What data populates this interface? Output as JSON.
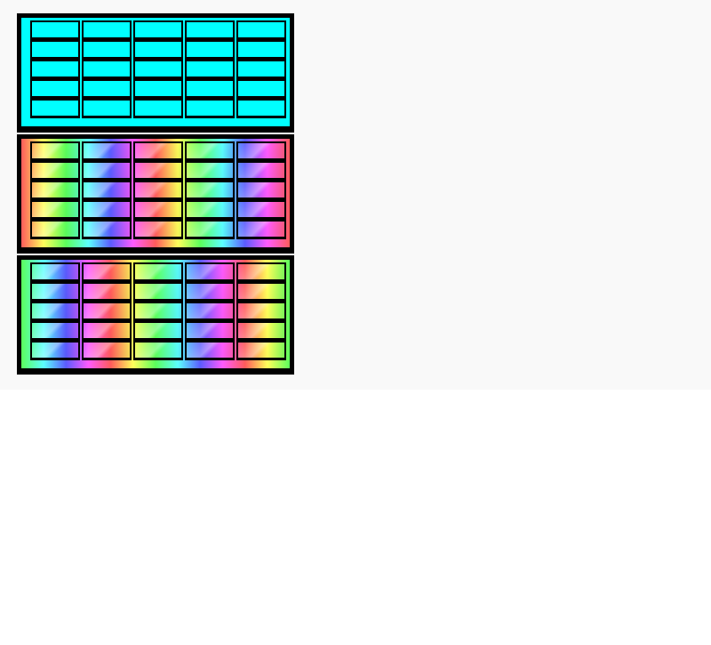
{
  "panels": [
    {
      "id": "panel-1",
      "fill": "solid-cyan",
      "color": "#00ffff",
      "rows": 5,
      "cols": 5
    },
    {
      "id": "panel-2",
      "fill": "rainbow-diagonal",
      "rows": 5,
      "cols": 5
    },
    {
      "id": "panel-3",
      "fill": "rainbow-diagonal",
      "rows": 5,
      "cols": 5
    }
  ],
  "colors": {
    "page_background": "#f9f9f9",
    "outer_background": "#ffffff",
    "frame": "#000000",
    "solid_panel": "#00ffff"
  }
}
